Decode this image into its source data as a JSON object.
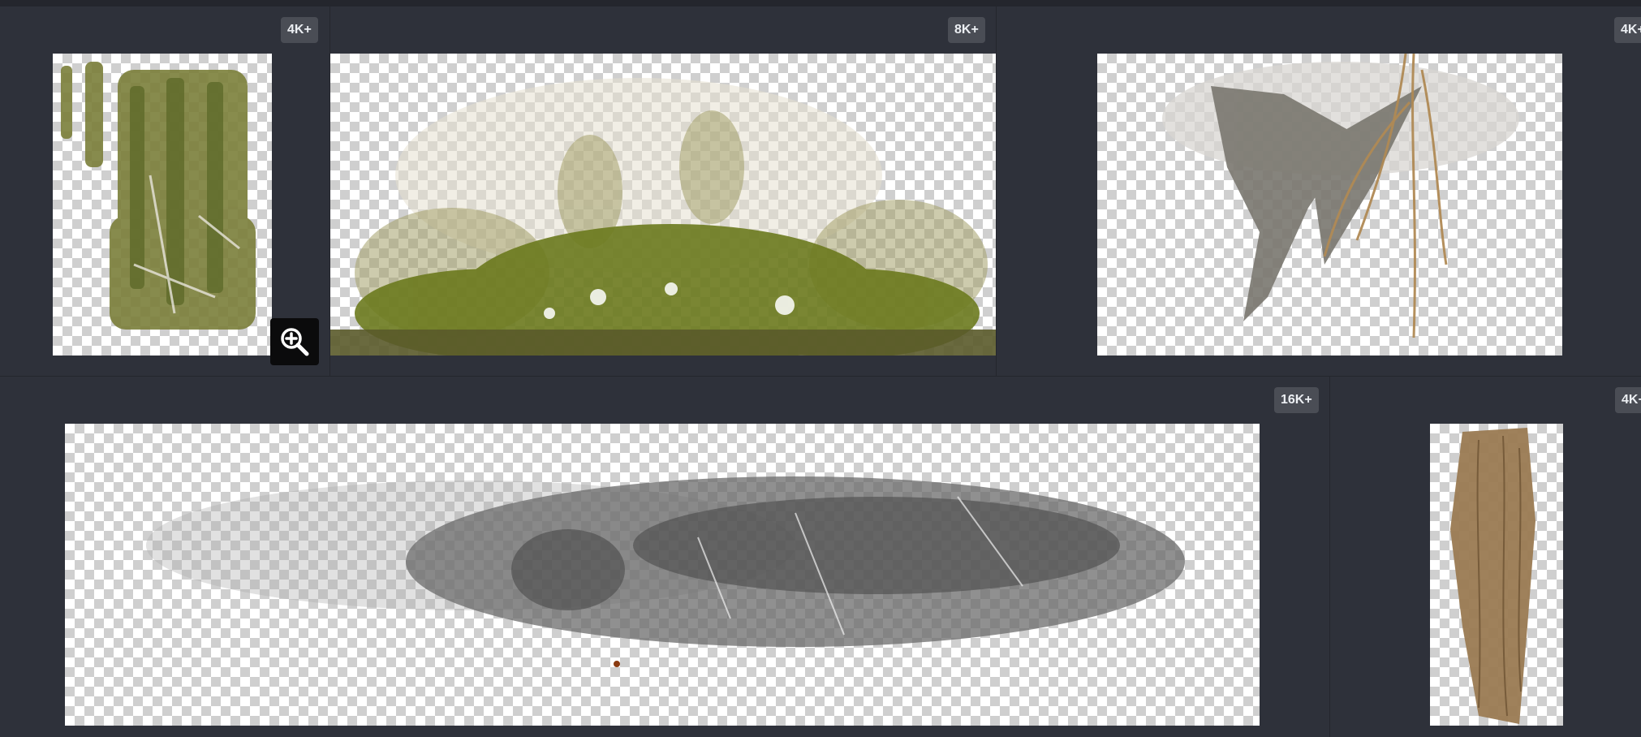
{
  "gallery": {
    "items": [
      {
        "badge": "4K+",
        "color": "#7b7f3a",
        "icon": "moss-texture"
      },
      {
        "badge": "8K+",
        "color": "#6c7a1e",
        "icon": "moss-bush-texture"
      },
      {
        "badge": "4K+",
        "color": "#8a8278",
        "icon": "roots-texture"
      },
      {
        "badge": "16K+",
        "color": "#6b6b6b",
        "icon": "dirt-texture"
      },
      {
        "badge": "4K+",
        "color": "#9a7a52",
        "icon": "hanging-roots-texture"
      }
    ]
  },
  "zoom_button": {
    "icon": "zoom-in-icon"
  }
}
